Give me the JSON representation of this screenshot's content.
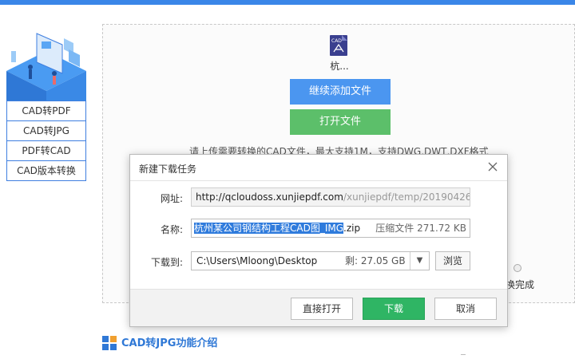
{
  "sidebar": {
    "items": [
      {
        "label": "CAD转PDF"
      },
      {
        "label": "CAD转JPG"
      },
      {
        "label": "PDF转CAD"
      },
      {
        "label": "CAD版本转换"
      }
    ]
  },
  "main": {
    "file_name": "杭...",
    "file_badge": "CAD",
    "add_button": "继续添加文件",
    "open_button": "打开文件",
    "hint": "请上传需要转换的CAD文件，最大支持1M，支持DWG,DWT,DXF格式",
    "status_text": "换完成",
    "section_title": "CAD转JPG功能介绍"
  },
  "dialog": {
    "title": "新建下载任务",
    "url_label": "网址:",
    "url_host": "http://qcloudoss.xunjiepdf.com",
    "url_path": "/xunjiepdf/temp/20190426/",
    "name_label": "名称:",
    "name_selected": "杭州某公司钢结构工程CAD图_IMG",
    "name_ext": ".zip",
    "name_meta": "压缩文件 271.72 KB",
    "download_to_label": "下载到:",
    "path": "C:\\Users\\Mloong\\Desktop",
    "free_space": "剩: 27.05 GB",
    "browse_button": "浏览",
    "direct_open_button": "直接打开",
    "download_button": "下载",
    "cancel_button": "取消"
  },
  "colors": {
    "accent_blue": "#4b96f0",
    "green": "#5cbf6a",
    "download_green": "#2fb564",
    "selection": "#2f7bdc"
  }
}
